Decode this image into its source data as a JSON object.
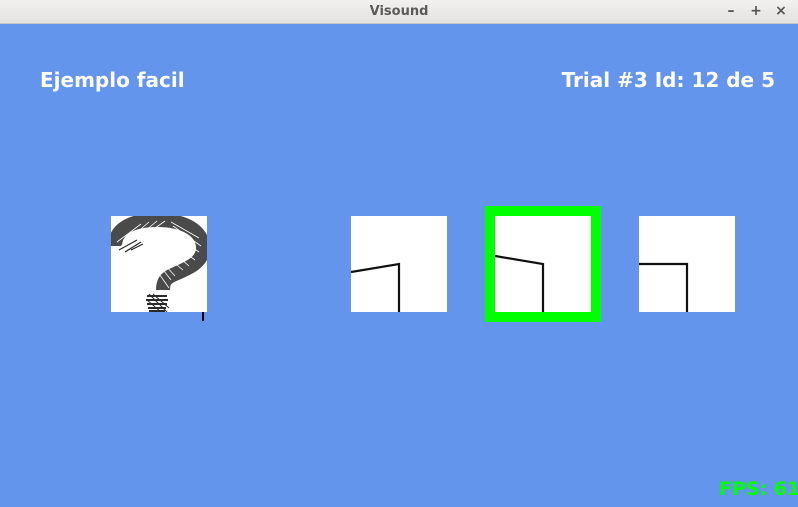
{
  "window": {
    "title": "Visound",
    "minimize_glyph": "–",
    "maximize_glyph": "+",
    "close_glyph": "×"
  },
  "header": {
    "example_label": "Ejemplo facil",
    "trial_label": "Trial #3 Id: 12 de 5"
  },
  "stimulus": {
    "icon": "question-mark-sketch-icon"
  },
  "options": [
    {
      "icon": "angle-shape-1",
      "selected": false
    },
    {
      "icon": "angle-shape-2",
      "selected": true
    },
    {
      "icon": "angle-shape-3",
      "selected": false
    }
  ],
  "status": {
    "fps_text": "FPS: 61"
  },
  "colors": {
    "background": "#6495ED",
    "selection": "#00ff00",
    "fps": "#00ff00",
    "header_text": "#ffffff"
  }
}
